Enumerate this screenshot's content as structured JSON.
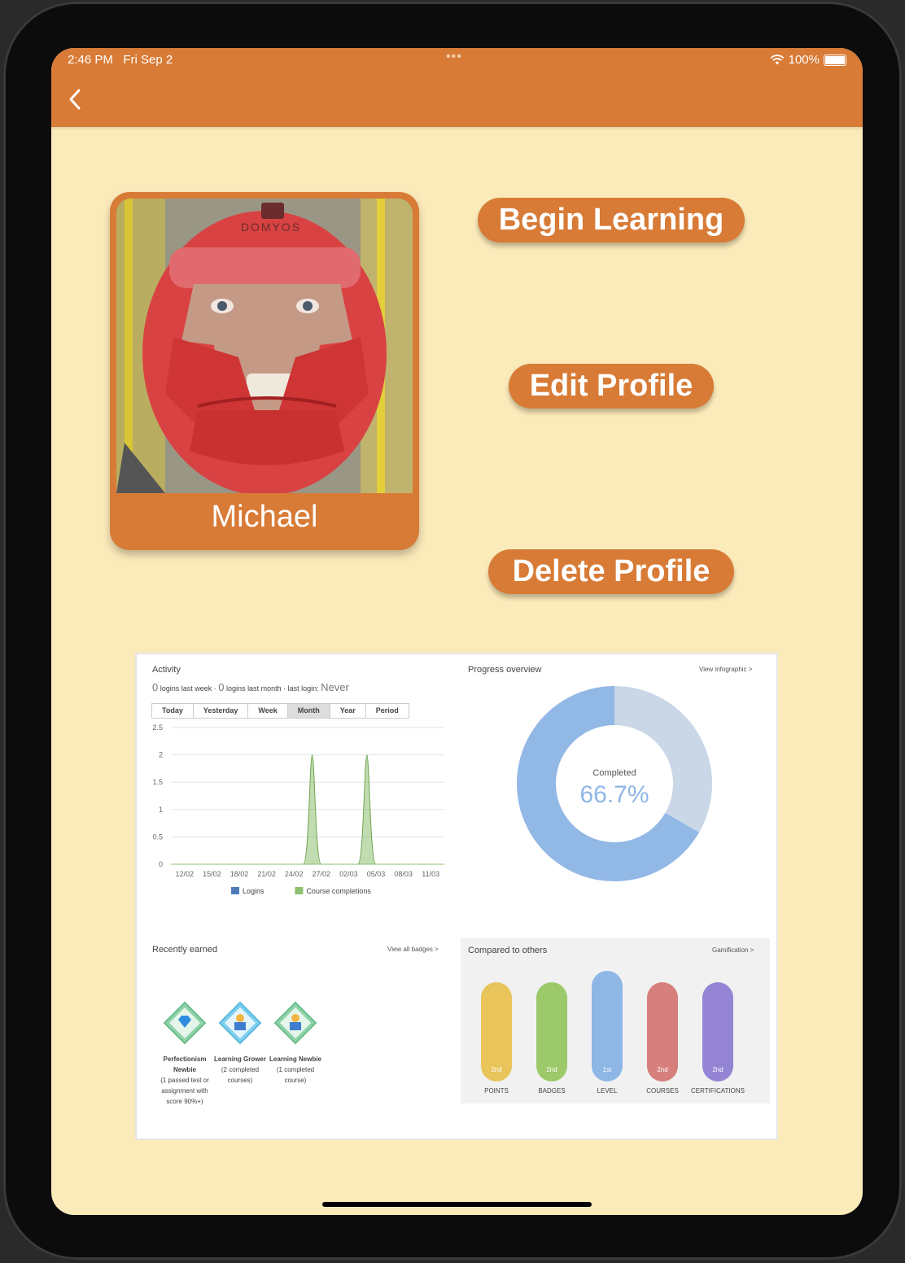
{
  "status": {
    "time": "2:46 PM",
    "date": "Fri Sep 2",
    "dots": "•••",
    "battery": "100%"
  },
  "profile": {
    "name": "Michael",
    "helmet_brand": "DOMYOS"
  },
  "actions": {
    "begin": "Begin Learning",
    "edit": "Edit Profile",
    "delete": "Delete Profile"
  },
  "activity": {
    "title": "Activity",
    "logins_week_count": "0",
    "logins_week_text": "logins last week ·",
    "logins_month_count": "0",
    "logins_month_text": "logins last month · last login:",
    "last_login": "Never",
    "tabs": [
      "Today",
      "Yesterday",
      "Week",
      "Month",
      "Year",
      "Period"
    ],
    "active_tab": "Month"
  },
  "chart_data": {
    "type": "area",
    "x": [
      "12/02",
      "15/02",
      "18/02",
      "21/02",
      "24/02",
      "27/02",
      "02/03",
      "05/03",
      "08/03",
      "11/03"
    ],
    "y_ticks": [
      "0",
      "0.5",
      "1",
      "1.5",
      "2",
      "2.5"
    ],
    "ylim": [
      0,
      2.5
    ],
    "grid": true,
    "series": [
      {
        "name": "Logins",
        "color": "#4f7ab8",
        "values": [
          0,
          0,
          0,
          0,
          0,
          0,
          0,
          0,
          0,
          0
        ]
      },
      {
        "name": "Course completions",
        "color": "#8cbf6f",
        "peaks": [
          {
            "x": "26/02",
            "y": 2
          },
          {
            "x": "04/03",
            "y": 2
          }
        ]
      }
    ],
    "legend_position": "bottom"
  },
  "progress": {
    "title": "Progress overview",
    "link": "View infographic >",
    "center_label": "Completed",
    "percent_label": "66.7%",
    "completed_fraction": 0.667,
    "colors": {
      "done": "#92b8e6",
      "rest": "#c9d7e6"
    }
  },
  "badges": {
    "title": "Recently earned",
    "link": "View all badges >",
    "items": [
      {
        "name": "Perfectionism Newbie",
        "desc": "(1 passed test or assignment with score 90%+)",
        "icon": "diamond-icon"
      },
      {
        "name": "Learning Grower",
        "desc": "(2 completed courses)",
        "icon": "learner-icon"
      },
      {
        "name": "Learning Newbie",
        "desc": "(1 completed course)",
        "icon": "learner-icon"
      }
    ]
  },
  "compare": {
    "title": "Compared to others",
    "link": "Gamification >",
    "items": [
      {
        "label": "POINTS",
        "rank": "2nd",
        "color": "#e8c45a"
      },
      {
        "label": "BADGES",
        "rank": "2nd",
        "color": "#9cc96a"
      },
      {
        "label": "LEVEL",
        "rank": "1st",
        "color": "#8eb7e6"
      },
      {
        "label": "COURSES",
        "rank": "2nd",
        "color": "#d67f7d"
      },
      {
        "label": "CERTIFICATIONS",
        "rank": "2nd",
        "color": "#9484d4"
      }
    ]
  }
}
